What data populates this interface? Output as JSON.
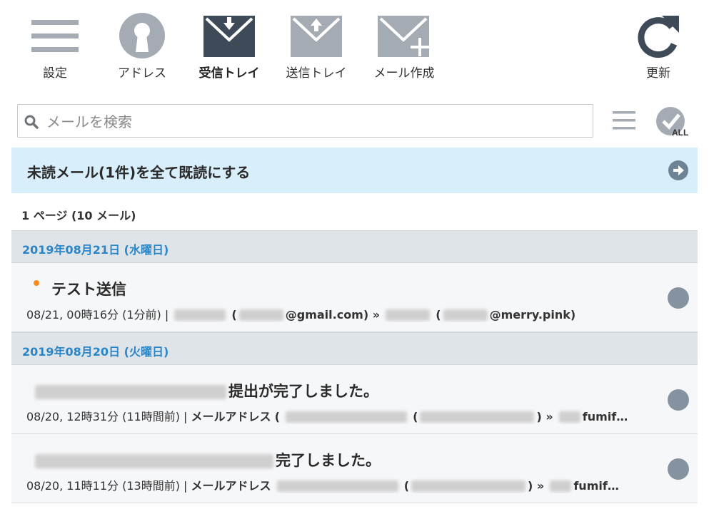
{
  "toolbar": {
    "settings_label": "設定",
    "address_label": "アドレス",
    "inbox_label": "受信トレイ",
    "sent_label": "送信トレイ",
    "compose_label": "メール作成",
    "refresh_label": "更新"
  },
  "search": {
    "placeholder": "メールを検索",
    "value": "",
    "all_badge": "ALL"
  },
  "unread_bar": {
    "label": "未読メール(1件)を全て既読にする"
  },
  "page_info": "1 ページ (10 メール)",
  "groups": [
    {
      "date": "2019年08月21日 (水曜日)",
      "mails": [
        {
          "subject": "テスト送信",
          "unread": true,
          "time": "08/21, 00時16分 (1分前) |",
          "from_addr": "@gmail.com) »",
          "to_addr": "@merry.pink)"
        }
      ]
    },
    {
      "date": "2019年08月20日 (火曜日)",
      "mails": [
        {
          "subject": "提出が完了しました。",
          "unread": false,
          "time": "08/20, 12時31分 (11時間前) |",
          "sender_name": "メールアドレス",
          "paren_open": "(",
          "paren_close": ") »",
          "to_addr": "fumif…"
        },
        {
          "subject": "完了しました。",
          "unread": false,
          "time": "08/20, 11時11分 (13時間前) |",
          "sender_name": "メールアドレス",
          "paren_open": "(",
          "paren_close": ") »",
          "to_addr": "fumif…"
        }
      ]
    }
  ],
  "colors": {
    "accent_blue": "#2b86c8",
    "unread_dot": "#ff8a1c",
    "banner_bg": "#d8eefb",
    "icon_gray": "#a4abb3",
    "icon_dark": "#3f4a59"
  },
  "icons": {
    "settings": "hamburger-icon",
    "address": "keyhole-icon",
    "inbox": "envelope-down-icon",
    "sent": "envelope-up-icon",
    "compose": "envelope-plus-icon",
    "refresh": "refresh-icon",
    "search": "search-icon",
    "list_menu": "list-menu-icon",
    "select_all": "check-all-icon",
    "mark_read": "arrow-right-circle-icon"
  }
}
